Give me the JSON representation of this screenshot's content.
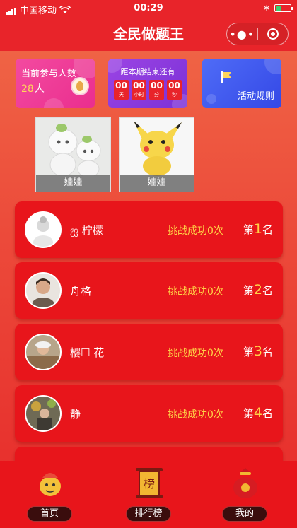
{
  "status_bar": {
    "carrier": "中国移动",
    "time": "00:29"
  },
  "nav": {
    "title": "全民做题王"
  },
  "participants": {
    "label": "当前参与人数",
    "count": "28",
    "unit": "人"
  },
  "countdown": {
    "label": "距本期结束还有",
    "units": [
      {
        "value": "00",
        "label": "天"
      },
      {
        "value": "00",
        "label": "小时"
      },
      {
        "value": "00",
        "label": "分"
      },
      {
        "value": "00",
        "label": "秒"
      }
    ]
  },
  "rules": {
    "label": "活动规则"
  },
  "prizes": [
    {
      "caption": "娃娃"
    },
    {
      "caption": "娃娃"
    }
  ],
  "ranking": [
    {
      "name": "ஐ 柠檬",
      "stat": "挑战成功0次",
      "prefix": "第",
      "rank": "1",
      "suffix": "名"
    },
    {
      "name": "舟格",
      "stat": "挑战成功0次",
      "prefix": "第",
      "rank": "2",
      "suffix": "名"
    },
    {
      "name": "樱☐  花",
      "stat": "挑战成功0次",
      "prefix": "第",
      "rank": "3",
      "suffix": "名"
    },
    {
      "name": "静",
      "stat": "挑战成功0次",
      "prefix": "第",
      "rank": "4",
      "suffix": "名"
    }
  ],
  "tabs": {
    "home": "首页",
    "leaderboard": "排行榜",
    "mine": "我的",
    "board_char": "榜"
  },
  "colors": {
    "primary_red": "#e8151b",
    "gold": "#ffd347"
  }
}
